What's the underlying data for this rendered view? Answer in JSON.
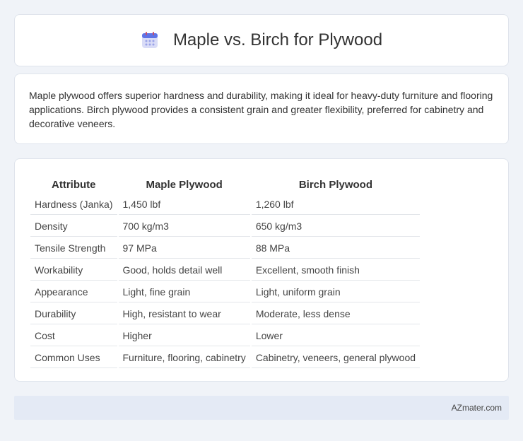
{
  "header": {
    "title": "Maple vs. Birch for Plywood",
    "icon": "calendar-icon"
  },
  "summary": {
    "text": "Maple plywood offers superior hardness and durability, making it ideal for heavy-duty furniture and flooring applications. Birch plywood provides a consistent grain and greater flexibility, preferred for cabinetry and decorative veneers."
  },
  "table": {
    "headers": [
      "Attribute",
      "Maple Plywood",
      "Birch Plywood"
    ],
    "rows": [
      [
        "Hardness (Janka)",
        "1,450 lbf",
        "1,260 lbf"
      ],
      [
        "Density",
        "700 kg/m3",
        "650 kg/m3"
      ],
      [
        "Tensile Strength",
        "97 MPa",
        "88 MPa"
      ],
      [
        "Workability",
        "Good, holds detail well",
        "Excellent, smooth finish"
      ],
      [
        "Appearance",
        "Light, fine grain",
        "Light, uniform grain"
      ],
      [
        "Durability",
        "High, resistant to wear",
        "Moderate, less dense"
      ],
      [
        "Cost",
        "Higher",
        "Lower"
      ],
      [
        "Common Uses",
        "Furniture, flooring, cabinetry",
        "Cabinetry, veneers, general plywood"
      ]
    ]
  },
  "footer": {
    "brand": "AZmater.com"
  }
}
